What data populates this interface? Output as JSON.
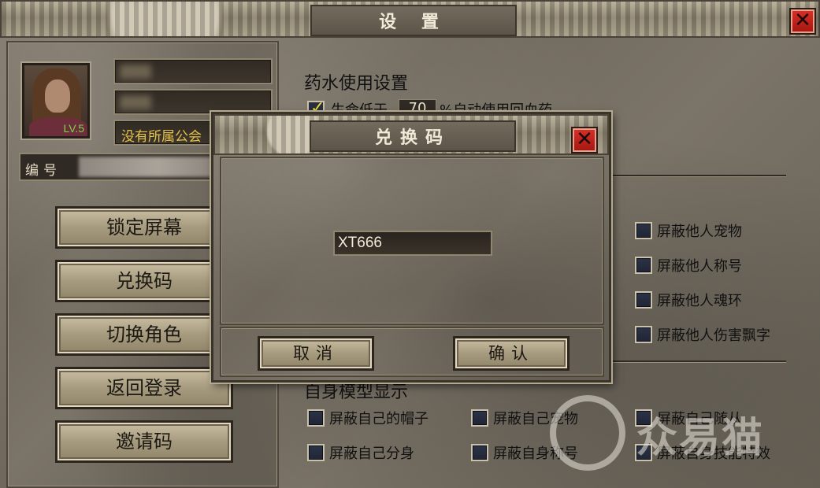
{
  "main_window": {
    "title": "设 置",
    "close_glyph": "✕"
  },
  "profile": {
    "level": "LV.5",
    "guild": "没有所属公会",
    "id_label": "编号"
  },
  "side_buttons": [
    {
      "label": "锁定屏幕"
    },
    {
      "label": "兑换码"
    },
    {
      "label": "切换角色"
    },
    {
      "label": "返回登录"
    },
    {
      "label": "邀请码"
    }
  ],
  "potion_settings": {
    "heading": "药水使用设置",
    "hp_prefix": "生命低于",
    "hp_value": "70",
    "hp_suffix": "%自动使用回血药",
    "hp_checked": true
  },
  "display_settings": {
    "options": [
      {
        "label": "屏蔽他人宠物"
      },
      {
        "label": "屏蔽他人称号"
      },
      {
        "label": "屏蔽他人魂环"
      },
      {
        "label": "屏蔽他人伤害飘字"
      }
    ]
  },
  "self_model": {
    "heading": "自身模型显示",
    "options": [
      {
        "label": "屏蔽自己的帽子"
      },
      {
        "label": "屏蔽自己宠物"
      },
      {
        "label": "屏蔽自己随从"
      },
      {
        "label": "屏蔽自己分身"
      },
      {
        "label": "屏蔽自身称号"
      },
      {
        "label": "屏蔽自身技能特效"
      }
    ]
  },
  "dialog": {
    "title": "兑换码",
    "close_glyph": "✕",
    "input_value": "XT666",
    "cancel_label": "取消",
    "confirm_label": "确认"
  },
  "watermark": {
    "text": "众易猫"
  },
  "icons": {
    "close": "close-icon",
    "check": "check-icon"
  },
  "colors": {
    "guild_text": "#e7c24a",
    "level_text": "#7dd34a",
    "close_red": "#c8231d",
    "checkbox_blue": "#2d3348"
  }
}
